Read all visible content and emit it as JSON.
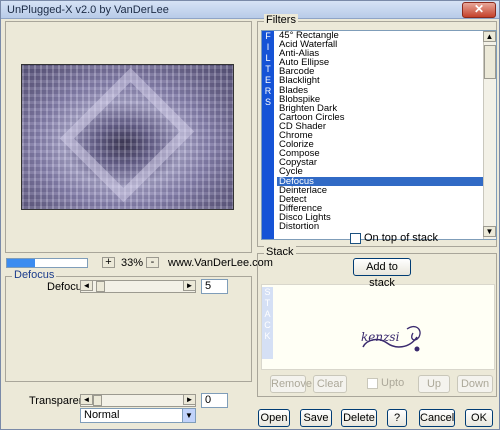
{
  "window": {
    "title": "UnPlugged-X v2.0 by VanDerLee",
    "close_glyph": "✕"
  },
  "preview": {
    "zoom": "33%",
    "minus": "-",
    "plus": "+",
    "site": "www.VanDerLee.com",
    "progress_fraction": 0.35
  },
  "defocus": {
    "group_title": "Defocus",
    "param_label": "Defocus",
    "param_value": "5",
    "slider_fraction": 0.04
  },
  "transparency": {
    "label": "Transparency",
    "value": "0",
    "slider_fraction": 0.0,
    "blend_mode": "Normal"
  },
  "filters": {
    "group_title": "Filters",
    "side_label": [
      "F",
      "I",
      "L",
      "T",
      "E",
      "R",
      "S"
    ],
    "items": [
      "45° Rectangle",
      "Acid Waterfall",
      "Anti-Alias",
      "Auto Ellipse",
      "Barcode",
      "Blacklight",
      "Blades",
      "Blobspike",
      "Brighten Dark",
      "Cartoon Circles",
      "CD Shader",
      "Chrome",
      "Colorize",
      "Compose",
      "Copystar",
      "Cycle",
      "Defocus",
      "Deinterlace",
      "Detect",
      "Difference",
      "Disco Lights",
      "Distortion"
    ],
    "selected": "Defocus",
    "on_top_label": "On top of stack"
  },
  "stack": {
    "group_title": "Stack",
    "add_button": "Add to stack",
    "side_label": [
      "S",
      "T",
      "A",
      "C",
      "K"
    ],
    "logo_text": "kenzsi",
    "remove": "Remove",
    "clear": "Clear",
    "upto": "Upto",
    "up": "Up",
    "down": "Down"
  },
  "footer": {
    "open": "Open",
    "save": "Save",
    "delete": "Delete",
    "help": "?",
    "cancel": "Cancel",
    "ok": "OK"
  },
  "icons": {
    "scroll_left": "◄",
    "scroll_right": "►",
    "scroll_up": "▲",
    "scroll_down": "▼",
    "dropdown": "▼"
  },
  "colors": {
    "accent": "#1553d6",
    "selection": "#316ac5",
    "progress": "#3c8cf0"
  }
}
